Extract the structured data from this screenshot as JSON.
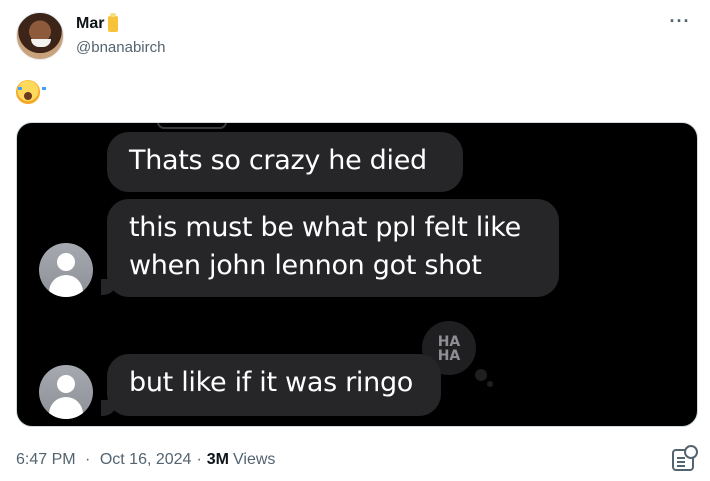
{
  "author": {
    "display_name": "Mar",
    "handle": "@bnanabirch",
    "avatar_icon": "profile-avatar",
    "name_badge_icon": "juice-box-emoji"
  },
  "post": {
    "text_emoji": "loudly-crying-face-emoji"
  },
  "media": {
    "messages": [
      {
        "text": "Thats so crazy he died"
      },
      {
        "text": "this must be what ppl felt like when john lennon got shot"
      },
      {
        "text": "but like if it was ringo"
      }
    ],
    "tapback": {
      "line1": "HA",
      "line2": "HA"
    }
  },
  "meta": {
    "time": "6:47 PM",
    "date": "Oct 16, 2024",
    "views_count": "3M",
    "views_label": "Views"
  },
  "colors": {
    "text_primary": "#0f1419",
    "text_secondary": "#536471",
    "bubble_bg": "#262629",
    "media_bg": "#000000"
  }
}
